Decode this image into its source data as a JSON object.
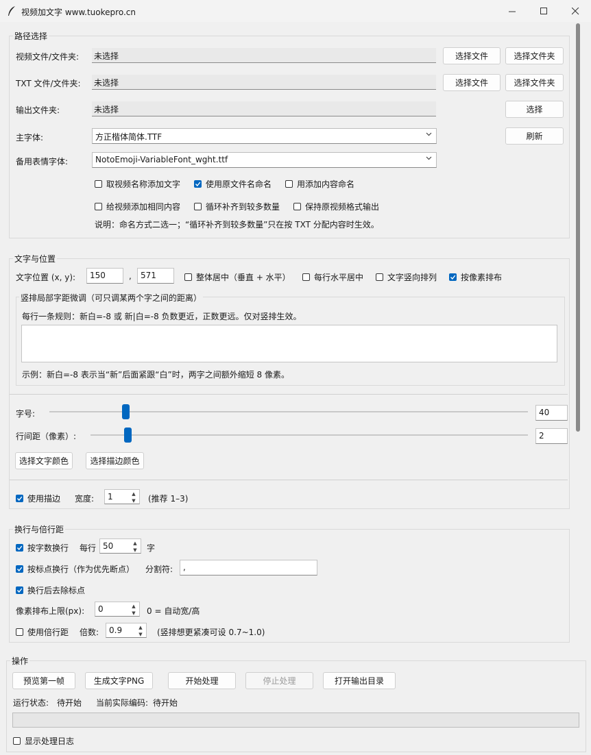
{
  "window": {
    "title": "视频加文字   www.tuokepro.cn"
  },
  "path_section": {
    "title": "路径选择",
    "video_label": "视频文件/文件夹:",
    "video_value": "未选择",
    "txt_label": "TXT 文件/文件夹:",
    "txt_value": "未选择",
    "output_label": "输出文件夹:",
    "output_value": "未选择",
    "select_file": "选择文件",
    "select_folder": "选择文件夹",
    "select": "选择",
    "refresh": "刷新",
    "main_font_label": "主字体:",
    "main_font_value": "方正楷体简体.TTF",
    "emoji_font_label": "备用表情字体:",
    "emoji_font_value": "NotoEmoji-VariableFont_wght.ttf",
    "opt_video_name": "取视频名称添加文字",
    "opt_use_original": "使用原文件名命名",
    "opt_use_content": "用添加内容命名",
    "opt_same_content": "给视频添加相同内容",
    "opt_loop_fill": "循环补齐到较多数量",
    "opt_keep_format": "保持原视频格式输出",
    "note": "说明：命名方式二选一；“循环补齐到较多数量”只在按 TXT 分配内容时生效。"
  },
  "text_section": {
    "title": "文字与位置",
    "pos_label": "文字位置 (x, y):",
    "x": "150",
    "comma": ",",
    "y": "571",
    "opt_center_all": "整体居中（垂直 + 水平）",
    "opt_center_line": "每行水平居中",
    "opt_vertical": "文字竖向排列",
    "opt_pixel": "按像素排布",
    "spacing_title": "竖排局部字距微调（可只调某两个字之间的距离）",
    "spacing_rule": "每行一条规则：新白=-8  或  新|白=-8    负数更近，正数更远。仅对竖排生效。",
    "spacing_example": "示例：新白=-8  表示当“新”后面紧跟“白”时，两字之间额外缩短 8 像素。",
    "font_size_label": "字号:",
    "font_size": "40",
    "font_size_level": 0.1,
    "line_gap_label": "行间距（像素）:",
    "line_gap": "2",
    "line_gap_level": 0.02,
    "text_color_btn": "选择文字颜色",
    "stroke_color_btn": "选择描边颜色",
    "use_stroke": "使用描边",
    "width_label": "宽度:",
    "width": "1",
    "width_hint": "(推荐 1–3)"
  },
  "wrap_section": {
    "title": "换行与倍行距",
    "by_count": "按字数换行",
    "per_line_label": "每行",
    "per_line": "50",
    "chars_unit": "字",
    "by_punct": "按标点换行（作为优先断点）",
    "sep_label": "分割符:",
    "sep_value": ",",
    "remove_punct": "换行后去除标点",
    "pixel_limit_label": "像素排布上限(px):",
    "pixel_limit": "0",
    "pixel_limit_hint": "0 = 自动宽/高",
    "use_multiplier": "使用倍行距",
    "multiplier_label": "倍数:",
    "multiplier": "0.9",
    "multiplier_hint": "(竖排想更紧凑可设 0.7~1.0)"
  },
  "ops_section": {
    "title": "操作",
    "preview": "预览第一帧",
    "gen_png": "生成文字PNG",
    "start": "开始处理",
    "stop": "停止处理",
    "open_output": "打开输出目录",
    "status_label": "运行状态:",
    "status_value": "待开始",
    "encoding_label": "当前实际编码:",
    "encoding_value": "待开始",
    "show_log": "显示处理日志"
  },
  "colors": {
    "accent": "#0067c0",
    "bg": "#f0f0f0"
  },
  "icons": [
    "feather-icon",
    "minimize-icon",
    "maximize-icon",
    "close-icon",
    "chevron-down-icon",
    "checkmark-icon",
    "spin-up-icon",
    "spin-down-icon"
  ]
}
